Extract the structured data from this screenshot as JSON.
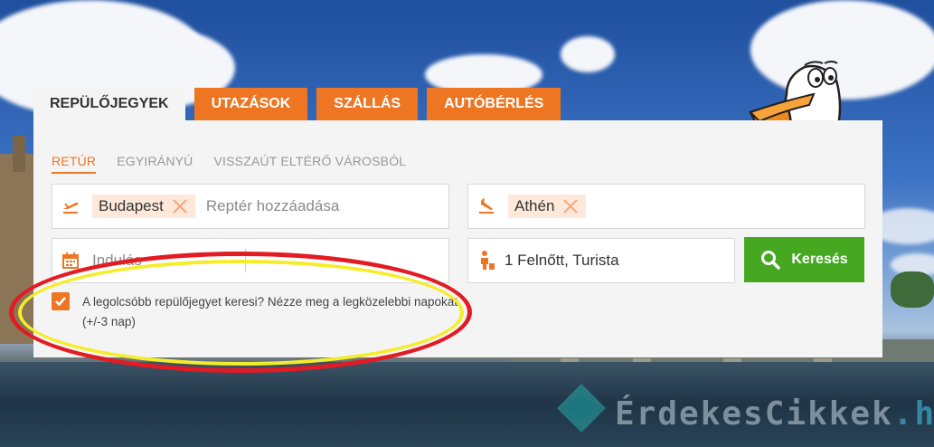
{
  "tabs": [
    {
      "label": "REPÜLŐJEGYEK",
      "active": true
    },
    {
      "label": "UTAZÁSOK"
    },
    {
      "label": "SZÁLLÁS"
    },
    {
      "label": "AUTÓBÉRLÉS"
    }
  ],
  "subtabs": [
    {
      "label": "RETÚR",
      "active": true
    },
    {
      "label": "EGYIRÁNYÚ"
    },
    {
      "label": "VISSZAÚT ELTÉRŐ VÁROSBÓL"
    }
  ],
  "from": {
    "chip": "Budapest",
    "placeholder": "Reptér hozzáadása",
    "icon": "plane-takeoff-icon"
  },
  "to": {
    "chip": "Athén",
    "icon": "plane-landing-icon"
  },
  "dates": {
    "placeholder": "Indulás",
    "icon": "calendar-icon"
  },
  "passengers": {
    "value": "1 Felnőtt, Turista",
    "icon": "traveler-icon"
  },
  "search_button": {
    "label": "Keresés",
    "icon": "search-icon"
  },
  "flexible_dates": {
    "label": "A legolcsóbb repülőjegyet keresi? Nézze meg a legközelebbi napokat (+/-3 nap)",
    "checked": true
  },
  "watermark": {
    "main": "ÉrdekesCikkek",
    "suffix": ".hu"
  },
  "colors": {
    "accent": "#ee7623",
    "search": "#46a820",
    "chip_bg": "#fde8d9",
    "ellipse_red": "#e31b23",
    "ellipse_yellow": "#f5ec2a"
  }
}
